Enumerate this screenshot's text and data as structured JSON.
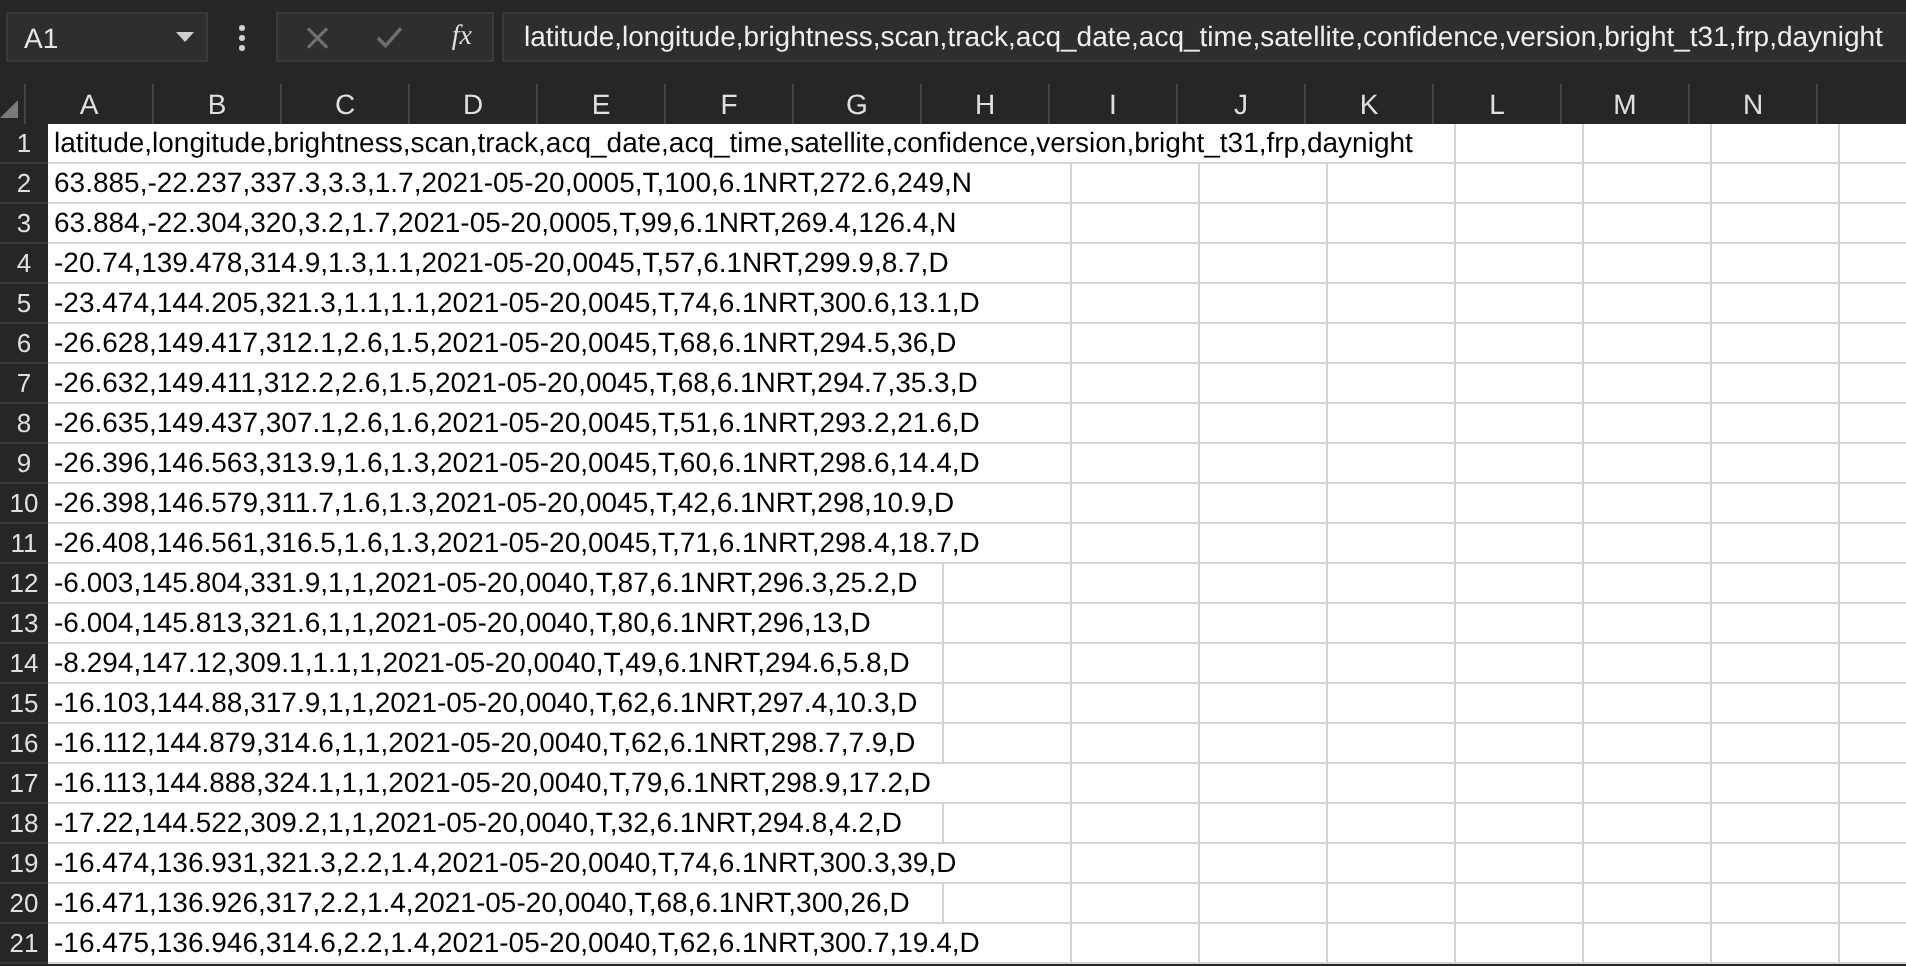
{
  "formula_bar": {
    "name_box": "A1",
    "cancel_disabled": true,
    "enter_disabled": true,
    "function_label": "fx",
    "formula": "latitude,longitude,brightness,scan,track,acq_date,acq_time,satellite,confidence,version,bright_t31,frp,daynight"
  },
  "columns": [
    "A",
    "B",
    "C",
    "D",
    "E",
    "F",
    "G",
    "H",
    "I",
    "J",
    "K",
    "L",
    "M",
    "N"
  ],
  "rows": [
    {
      "number": "1",
      "text": "latitude,longitude,brightness,scan,track,acq_date,acq_time,satellite,confidence,version,bright_t31,frp,daynight"
    },
    {
      "number": "2",
      "text": "63.885,-22.237,337.3,3.3,1.7,2021-05-20,0005,T,100,6.1NRT,272.6,249,N"
    },
    {
      "number": "3",
      "text": "63.884,-22.304,320,3.2,1.7,2021-05-20,0005,T,99,6.1NRT,269.4,126.4,N"
    },
    {
      "number": "4",
      "text": "-20.74,139.478,314.9,1.3,1.1,2021-05-20,0045,T,57,6.1NRT,299.9,8.7,D"
    },
    {
      "number": "5",
      "text": "-23.474,144.205,321.3,1.1,1.1,2021-05-20,0045,T,74,6.1NRT,300.6,13.1,D"
    },
    {
      "number": "6",
      "text": "-26.628,149.417,312.1,2.6,1.5,2021-05-20,0045,T,68,6.1NRT,294.5,36,D"
    },
    {
      "number": "7",
      "text": "-26.632,149.411,312.2,2.6,1.5,2021-05-20,0045,T,68,6.1NRT,294.7,35.3,D"
    },
    {
      "number": "8",
      "text": "-26.635,149.437,307.1,2.6,1.6,2021-05-20,0045,T,51,6.1NRT,293.2,21.6,D"
    },
    {
      "number": "9",
      "text": "-26.396,146.563,313.9,1.6,1.3,2021-05-20,0045,T,60,6.1NRT,298.6,14.4,D"
    },
    {
      "number": "10",
      "text": "-26.398,146.579,311.7,1.6,1.3,2021-05-20,0045,T,42,6.1NRT,298,10.9,D"
    },
    {
      "number": "11",
      "text": "-26.408,146.561,316.5,1.6,1.3,2021-05-20,0045,T,71,6.1NRT,298.4,18.7,D"
    },
    {
      "number": "12",
      "text": "-6.003,145.804,331.9,1,1,2021-05-20,0040,T,87,6.1NRT,296.3,25.2,D"
    },
    {
      "number": "13",
      "text": "-6.004,145.813,321.6,1,1,2021-05-20,0040,T,80,6.1NRT,296,13,D"
    },
    {
      "number": "14",
      "text": "-8.294,147.12,309.1,1.1,1,2021-05-20,0040,T,49,6.1NRT,294.6,5.8,D"
    },
    {
      "number": "15",
      "text": "-16.103,144.88,317.9,1,1,2021-05-20,0040,T,62,6.1NRT,297.4,10.3,D"
    },
    {
      "number": "16",
      "text": "-16.112,144.879,314.6,1,1,2021-05-20,0040,T,62,6.1NRT,298.7,7.9,D"
    },
    {
      "number": "17",
      "text": "-16.113,144.888,324.1,1,1,2021-05-20,0040,T,79,6.1NRT,298.9,17.2,D"
    },
    {
      "number": "18",
      "text": "-17.22,144.522,309.2,1,1,2021-05-20,0040,T,32,6.1NRT,294.8,4.2,D"
    },
    {
      "number": "19",
      "text": "-16.474,136.931,321.3,2.2,1.4,2021-05-20,0040,T,74,6.1NRT,300.3,39,D"
    },
    {
      "number": "20",
      "text": "-16.471,136.926,317,2.2,1.4,2021-05-20,0040,T,68,6.1NRT,300,26,D"
    },
    {
      "number": "21",
      "text": "-16.475,136.946,314.6,2.2,1.4,2021-05-20,0040,T,62,6.1NRT,300.7,19.4,D"
    }
  ]
}
